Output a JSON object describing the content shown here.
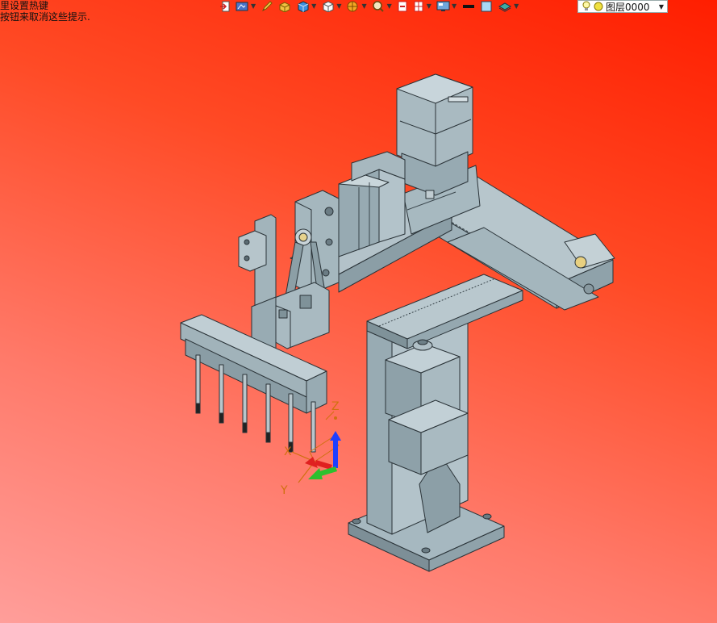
{
  "hint": {
    "line1": "里设置热键",
    "line2": "按钮来取消这些提示."
  },
  "toolbar": {
    "buttons": [
      {
        "icon": "exit-sketch-icon"
      },
      {
        "icon": "render-style-icon"
      },
      {
        "icon": "pencil-icon"
      },
      {
        "icon": "solid-shade-icon"
      },
      {
        "icon": "blue-cube-icon"
      },
      {
        "icon": "white-cube-icon"
      },
      {
        "icon": "orient-view-icon"
      },
      {
        "icon": "magnify-icon"
      },
      {
        "icon": "section-view-icon"
      },
      {
        "icon": "split-view-icon"
      },
      {
        "icon": "display-icon"
      },
      {
        "icon": "line-color-swatch-icon"
      },
      {
        "icon": "fill-color-swatch-icon"
      },
      {
        "icon": "layers-icon"
      }
    ],
    "colors": {
      "line_swatch": "#111111",
      "fill_swatch": "#a9d8f5"
    }
  },
  "layer": {
    "name": "图层0000"
  },
  "triad": {
    "x_label": "X",
    "y_label": "Y",
    "z_label": "Z"
  },
  "colors": {
    "background_top": "#ff1e00",
    "background_bottom": "#ff9e9a",
    "part_steel": "#9fb2ba",
    "axis_x": "#e02020",
    "axis_y": "#2ec02e",
    "axis_z": "#1f3fff",
    "axis_label": "#d07010"
  }
}
